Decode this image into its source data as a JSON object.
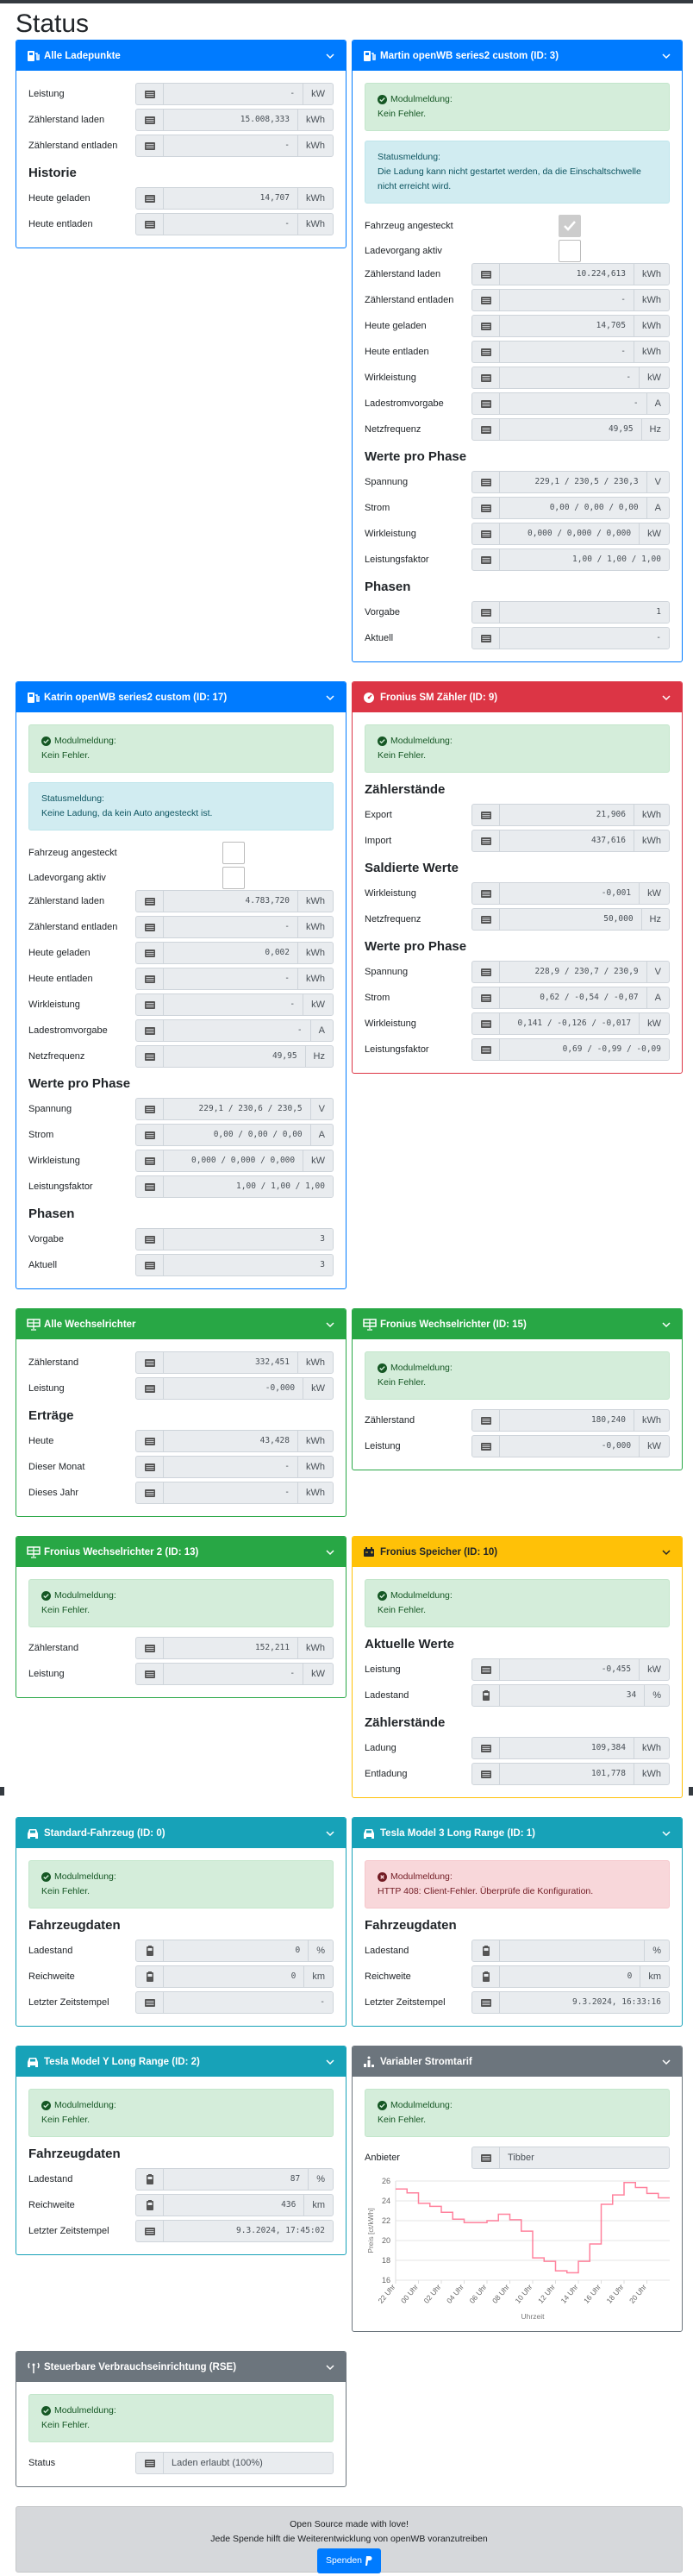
{
  "page_title": "Status",
  "cards": [
    {
      "title": "Alle Ladepunkte",
      "icon": "charging-station-icon",
      "color": "#007bff",
      "groups": [
        {
          "heading": "",
          "rows": [
            {
              "label": "Leistung",
              "icon": "list",
              "value": "-",
              "unit": "kW"
            },
            {
              "label": "Zählerstand laden",
              "icon": "list",
              "value": "15.008,333",
              "unit": "kWh"
            },
            {
              "label": "Zählerstand entladen",
              "icon": "list",
              "value": "-",
              "unit": "kWh"
            }
          ]
        },
        {
          "heading": "Historie",
          "rows": [
            {
              "label": "Heute geladen",
              "icon": "list",
              "value": "14,707",
              "unit": "kWh"
            },
            {
              "label": "Heute entladen",
              "icon": "list",
              "value": "-",
              "unit": "kWh"
            }
          ]
        }
      ]
    },
    {
      "title": "Martin openWB series2 custom (ID: 3)",
      "icon": "charging-station-icon",
      "color": "#007bff",
      "alerts": [
        {
          "type": "success",
          "title": "Modulmeldung:",
          "text": "Kein Fehler."
        },
        {
          "type": "info",
          "title": "Statusmeldung:",
          "text": "Die Ladung kann nicht gestartet werden, da die Einschaltschwelle nicht erreicht wird."
        }
      ],
      "checks": [
        {
          "label": "Fahrzeug angesteckt",
          "checked": true
        },
        {
          "label": "Ladevorgang aktiv",
          "checked": false
        }
      ],
      "groups": [
        {
          "heading": "",
          "rows": [
            {
              "label": "Zählerstand laden",
              "icon": "list",
              "value": "10.224,613",
              "unit": "kWh"
            },
            {
              "label": "Zählerstand entladen",
              "icon": "list",
              "value": "-",
              "unit": "kWh"
            },
            {
              "label": "Heute geladen",
              "icon": "list",
              "value": "14,705",
              "unit": "kWh"
            },
            {
              "label": "Heute entladen",
              "icon": "list",
              "value": "-",
              "unit": "kWh"
            },
            {
              "label": "Wirkleistung",
              "icon": "list",
              "value": "-",
              "unit": "kW"
            },
            {
              "label": "Ladestromvorgabe",
              "icon": "list",
              "value": "-",
              "unit": "A"
            },
            {
              "label": "Netzfrequenz",
              "icon": "list",
              "value": "49,95",
              "unit": "Hz"
            }
          ]
        },
        {
          "heading": "Werte pro Phase",
          "rows": [
            {
              "label": "Spannung",
              "icon": "list",
              "value": "229,1 / 230,5 / 230,3",
              "unit": "V"
            },
            {
              "label": "Strom",
              "icon": "list",
              "value": "0,00 / 0,00 / 0,00",
              "unit": "A"
            },
            {
              "label": "Wirkleistung",
              "icon": "list",
              "value": "0,000 / 0,000 / 0,000",
              "unit": "kW"
            },
            {
              "label": "Leistungsfaktor",
              "icon": "list",
              "value": "1,00 / 1,00 / 1,00",
              "unit": ""
            }
          ]
        },
        {
          "heading": "Phasen",
          "rows": [
            {
              "label": "Vorgabe",
              "icon": "list",
              "value": "1",
              "unit": ""
            },
            {
              "label": "Aktuell",
              "icon": "list",
              "value": "-",
              "unit": ""
            }
          ]
        }
      ]
    },
    {
      "title": "Katrin openWB series2 custom (ID: 17)",
      "icon": "charging-station-icon",
      "color": "#007bff",
      "alerts": [
        {
          "type": "success",
          "title": "Modulmeldung:",
          "text": "Kein Fehler."
        },
        {
          "type": "info",
          "title": "Statusmeldung:",
          "text": "Keine Ladung, da kein Auto angesteckt ist."
        }
      ],
      "checks": [
        {
          "label": "Fahrzeug angesteckt",
          "checked": false
        },
        {
          "label": "Ladevorgang aktiv",
          "checked": false
        }
      ],
      "groups": [
        {
          "heading": "",
          "rows": [
            {
              "label": "Zählerstand laden",
              "icon": "list",
              "value": "4.783,720",
              "unit": "kWh"
            },
            {
              "label": "Zählerstand entladen",
              "icon": "list",
              "value": "-",
              "unit": "kWh"
            },
            {
              "label": "Heute geladen",
              "icon": "list",
              "value": "0,002",
              "unit": "kWh"
            },
            {
              "label": "Heute entladen",
              "icon": "list",
              "value": "-",
              "unit": "kWh"
            },
            {
              "label": "Wirkleistung",
              "icon": "list",
              "value": "-",
              "unit": "kW"
            },
            {
              "label": "Ladestromvorgabe",
              "icon": "list",
              "value": "-",
              "unit": "A"
            },
            {
              "label": "Netzfrequenz",
              "icon": "list",
              "value": "49,95",
              "unit": "Hz"
            }
          ]
        },
        {
          "heading": "Werte pro Phase",
          "rows": [
            {
              "label": "Spannung",
              "icon": "list",
              "value": "229,1 / 230,6 / 230,5",
              "unit": "V"
            },
            {
              "label": "Strom",
              "icon": "list",
              "value": "0,00 / 0,00 / 0,00",
              "unit": "A"
            },
            {
              "label": "Wirkleistung",
              "icon": "list",
              "value": "0,000 / 0,000 / 0,000",
              "unit": "kW"
            },
            {
              "label": "Leistungsfaktor",
              "icon": "list",
              "value": "1,00 / 1,00 / 1,00",
              "unit": ""
            }
          ]
        },
        {
          "heading": "Phasen",
          "rows": [
            {
              "label": "Vorgabe",
              "icon": "list",
              "value": "3",
              "unit": ""
            },
            {
              "label": "Aktuell",
              "icon": "list",
              "value": "3",
              "unit": ""
            }
          ]
        }
      ]
    },
    {
      "title": "Fronius SM Zähler (ID: 9)",
      "icon": "gauge-icon",
      "color": "#dc3545",
      "alerts": [
        {
          "type": "success",
          "title": "Modulmeldung:",
          "text": "Kein Fehler."
        }
      ],
      "groups": [
        {
          "heading": "Zählerstände",
          "rows": [
            {
              "label": "Export",
              "icon": "list",
              "value": "21,906",
              "unit": "kWh"
            },
            {
              "label": "Import",
              "icon": "list",
              "value": "437,616",
              "unit": "kWh"
            }
          ]
        },
        {
          "heading": "Saldierte Werte",
          "rows": [
            {
              "label": "Wirkleistung",
              "icon": "list",
              "value": "-0,001",
              "unit": "kW"
            },
            {
              "label": "Netzfrequenz",
              "icon": "list",
              "value": "50,000",
              "unit": "Hz"
            }
          ]
        },
        {
          "heading": "Werte pro Phase",
          "rows": [
            {
              "label": "Spannung",
              "icon": "list",
              "value": "228,9 / 230,7 / 230,9",
              "unit": "V"
            },
            {
              "label": "Strom",
              "icon": "list",
              "value": "0,62 / -0,54 / -0,07",
              "unit": "A"
            },
            {
              "label": "Wirkleistung",
              "icon": "list",
              "value": "0,141 / -0,126 / -0,017",
              "unit": "kW"
            },
            {
              "label": "Leistungsfaktor",
              "icon": "list",
              "value": "0,69 / -0,99 / -0,09",
              "unit": ""
            }
          ]
        }
      ]
    },
    {
      "title": "Alle Wechselrichter",
      "icon": "solar-panel-icon",
      "color": "#28a745",
      "groups": [
        {
          "heading": "",
          "rows": [
            {
              "label": "Zählerstand",
              "icon": "list",
              "value": "332,451",
              "unit": "kWh"
            },
            {
              "label": "Leistung",
              "icon": "list",
              "value": "-0,000",
              "unit": "kW"
            }
          ]
        },
        {
          "heading": "Erträge",
          "rows": [
            {
              "label": "Heute",
              "icon": "list",
              "value": "43,428",
              "unit": "kWh"
            },
            {
              "label": "Dieser Monat",
              "icon": "list",
              "value": "-",
              "unit": "kWh"
            },
            {
              "label": "Dieses Jahr",
              "icon": "list",
              "value": "-",
              "unit": "kWh"
            }
          ]
        }
      ]
    },
    {
      "title": "Fronius Wechselrichter (ID: 15)",
      "icon": "solar-panel-icon",
      "color": "#28a745",
      "alerts": [
        {
          "type": "success",
          "title": "Modulmeldung:",
          "text": "Kein Fehler."
        }
      ],
      "groups": [
        {
          "heading": "",
          "rows": [
            {
              "label": "Zählerstand",
              "icon": "list",
              "value": "180,240",
              "unit": "kWh"
            },
            {
              "label": "Leistung",
              "icon": "list",
              "value": "-0,000",
              "unit": "kW"
            }
          ]
        }
      ]
    },
    {
      "title": "Fronius Wechselrichter 2 (ID: 13)",
      "icon": "solar-panel-icon",
      "color": "#28a745",
      "alerts": [
        {
          "type": "success",
          "title": "Modulmeldung:",
          "text": "Kein Fehler."
        }
      ],
      "groups": [
        {
          "heading": "",
          "rows": [
            {
              "label": "Zählerstand",
              "icon": "list",
              "value": "152,211",
              "unit": "kWh"
            },
            {
              "label": "Leistung",
              "icon": "list",
              "value": "-",
              "unit": "kW"
            }
          ]
        }
      ]
    },
    {
      "title": "Fronius Speicher (ID: 10)",
      "icon": "car-battery-icon",
      "color": "#ffc107",
      "dark_text": true,
      "alerts": [
        {
          "type": "success",
          "title": "Modulmeldung:",
          "text": "Kein Fehler."
        }
      ],
      "groups": [
        {
          "heading": "Aktuelle Werte",
          "rows": [
            {
              "label": "Leistung",
              "icon": "list",
              "value": "-0,455",
              "unit": "kW"
            },
            {
              "label": "Ladestand",
              "icon": "battery",
              "value": "34",
              "unit": "%"
            }
          ]
        },
        {
          "heading": "Zählerstände",
          "rows": [
            {
              "label": "Ladung",
              "icon": "list",
              "value": "109,384",
              "unit": "kWh"
            },
            {
              "label": "Entladung",
              "icon": "list",
              "value": "101,778",
              "unit": "kWh"
            }
          ]
        }
      ]
    },
    {
      "title": "Standard-Fahrzeug (ID: 0)",
      "icon": "car-icon",
      "color": "#17a2b8",
      "alerts": [
        {
          "type": "success",
          "title": "Modulmeldung:",
          "text": "Kein Fehler."
        }
      ],
      "groups": [
        {
          "heading": "Fahrzeugdaten",
          "rows": [
            {
              "label": "Ladestand",
              "icon": "battery",
              "value": "0",
              "unit": "%"
            },
            {
              "label": "Reichweite",
              "icon": "battery",
              "value": "0",
              "unit": "km"
            },
            {
              "label": "Letzter Zeitstempel",
              "icon": "list",
              "value": "-",
              "unit": ""
            }
          ]
        }
      ]
    },
    {
      "title": "Tesla Model 3 Long Range (ID: 1)",
      "icon": "car-icon",
      "color": "#17a2b8",
      "alerts": [
        {
          "type": "danger",
          "title": "Modulmeldung:",
          "text": "HTTP 408: Client-Fehler. Überprüfe die Konfiguration."
        }
      ],
      "groups": [
        {
          "heading": "Fahrzeugdaten",
          "rows": [
            {
              "label": "Ladestand",
              "icon": "battery",
              "value": "",
              "unit": "%"
            },
            {
              "label": "Reichweite",
              "icon": "battery",
              "value": "0",
              "unit": "km"
            },
            {
              "label": "Letzter Zeitstempel",
              "icon": "list",
              "value": "9.3.2024, 16:33:16",
              "unit": ""
            }
          ]
        }
      ]
    },
    {
      "title": "Tesla Model Y Long Range (ID: 2)",
      "icon": "car-icon",
      "color": "#17a2b8",
      "alerts": [
        {
          "type": "success",
          "title": "Modulmeldung:",
          "text": "Kein Fehler."
        }
      ],
      "groups": [
        {
          "heading": "Fahrzeugdaten",
          "rows": [
            {
              "label": "Ladestand",
              "icon": "battery",
              "value": "87",
              "unit": "%"
            },
            {
              "label": "Reichweite",
              "icon": "battery",
              "value": "436",
              "unit": "km"
            },
            {
              "label": "Letzter Zeitstempel",
              "icon": "list",
              "value": "9.3.2024, 17:45:02",
              "unit": ""
            }
          ]
        }
      ]
    },
    {
      "title": "Variabler Stromtarif",
      "icon": "chart-icon",
      "color": "#6c757d",
      "has_chart": true,
      "alerts": [
        {
          "type": "success",
          "title": "Modulmeldung:",
          "text": "Kein Fehler."
        }
      ],
      "groups": [
        {
          "heading": "",
          "rows": [
            {
              "label": "Anbieter",
              "icon": "list",
              "value": "Tibber",
              "unit": "",
              "kind": "text"
            }
          ]
        }
      ]
    },
    {
      "title": "Steuerbare Verbrauchseinrichtung (RSE)",
      "icon": "antenna-icon",
      "color": "#6c757d",
      "alerts": [
        {
          "type": "success",
          "title": "Modulmeldung:",
          "text": "Kein Fehler."
        }
      ],
      "groups": [
        {
          "heading": "",
          "rows": [
            {
              "label": "Status",
              "icon": "list",
              "value": "Laden erlaubt (100%)",
              "unit": "",
              "kind": "text"
            }
          ]
        }
      ]
    }
  ],
  "footer": {
    "line1": "Open Source made with love!",
    "line2": "Jede Spende hilft die Weiterentwicklung von openWB voranzutreiben",
    "button": "Spenden"
  },
  "chart_data": {
    "type": "line",
    "step": true,
    "xlabel": "Uhrzeit",
    "ylabel": "Preis [ct/kWh]",
    "ylim": [
      16,
      26
    ],
    "yticks": [
      16,
      18,
      20,
      22,
      24,
      26
    ],
    "xtick_labels": [
      "22 Uhr",
      "00 Uhr",
      "02 Uhr",
      "04 Uhr",
      "06 Uhr",
      "08 Uhr",
      "10 Uhr",
      "12 Uhr",
      "14 Uhr",
      "16 Uhr",
      "18 Uhr",
      "20 Uhr"
    ],
    "hours": [
      "22",
      "23",
      "00",
      "01",
      "02",
      "03",
      "04",
      "05",
      "06",
      "07",
      "08",
      "09",
      "10",
      "11",
      "12",
      "13",
      "14",
      "15",
      "16",
      "17",
      "18",
      "19",
      "20",
      "21"
    ],
    "values": [
      25.2,
      24.8,
      23.75,
      23.45,
      22.85,
      22.15,
      21.8,
      21.8,
      22.0,
      22.65,
      22.1,
      20.95,
      18.25,
      17.9,
      16.95,
      16.75,
      17.9,
      19.65,
      23.65,
      24.6,
      25.85,
      25.35,
      24.75,
      24.3
    ],
    "color": "#ff6384",
    "grid": true
  }
}
